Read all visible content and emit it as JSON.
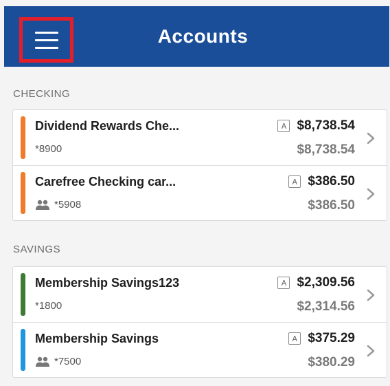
{
  "header": {
    "title": "Accounts",
    "menu_icon": "hamburger-menu-icon"
  },
  "sections": {
    "checking": {
      "label": "CHECKING",
      "accounts": [
        {
          "name": "Dividend Rewards Che...",
          "number": "*8900",
          "available_badge": "A",
          "available": "$8,738.54",
          "current": "$8,738.54",
          "color": "#f07c2a",
          "shared": false
        },
        {
          "name": "Carefree Checking car...",
          "number": "*5908",
          "available_badge": "A",
          "available": "$386.50",
          "current": "$386.50",
          "color": "#f07c2a",
          "shared": true
        }
      ]
    },
    "savings": {
      "label": "SAVINGS",
      "accounts": [
        {
          "name": "Membership Savings123",
          "number": "*1800",
          "available_badge": "A",
          "available": "$2,309.56",
          "current": "$2,314.56",
          "color": "#3f7a35",
          "shared": false
        },
        {
          "name": "Membership Savings",
          "number": "*7500",
          "available_badge": "A",
          "available": "$375.29",
          "current": "$380.29",
          "color": "#2196e0",
          "shared": true
        }
      ]
    }
  },
  "colors": {
    "header_bg": "#1a4e99",
    "highlight": "#e51f2a"
  }
}
